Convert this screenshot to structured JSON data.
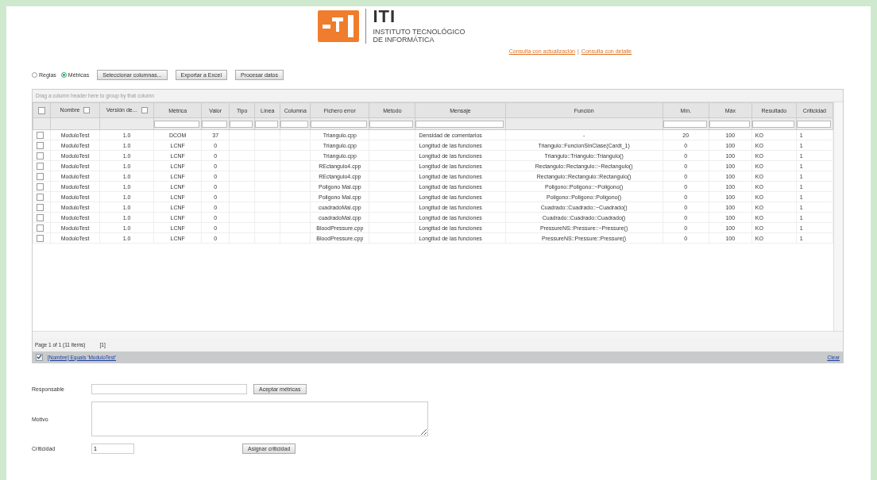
{
  "logo": {
    "acronym": "ITI",
    "name_line_1": "INSTITUTO TECNOLÓGICO",
    "name_line_2": "DE INFORMÁTICA"
  },
  "links": [
    "Consulta con actualización",
    "Consulta con detalle"
  ],
  "link_separator": "|",
  "mode_options": [
    {
      "label": "Reglas",
      "selected": false
    },
    {
      "label": "Métricas",
      "selected": true
    }
  ],
  "toolbar_buttons": [
    "Seleccionar columnas...",
    "Exportar a Excel",
    "Procesar datos"
  ],
  "grid": {
    "group_hint": "Drag a column header here to group by that column",
    "header_checked": false,
    "columns": [
      {
        "label": "Nombre",
        "filter": false,
        "menu": true
      },
      {
        "label": "Versión de...",
        "filter": false,
        "menu": true
      },
      {
        "label": "Métrica",
        "filter": true,
        "menu": false
      },
      {
        "label": "Valor",
        "filter": true,
        "menu": false
      },
      {
        "label": "Tipo",
        "filter": true,
        "menu": false
      },
      {
        "label": "Línea",
        "filter": true,
        "menu": false
      },
      {
        "label": "Columna",
        "filter": true,
        "menu": false
      },
      {
        "label": "Fichero error",
        "filter": true,
        "menu": false
      },
      {
        "label": "Método",
        "filter": true,
        "menu": false
      },
      {
        "label": "Mensaje",
        "filter": true,
        "menu": false
      },
      {
        "label": "Función",
        "filter": false,
        "menu": false
      },
      {
        "label": "Mín.",
        "filter": true,
        "menu": false
      },
      {
        "label": "Máx",
        "filter": true,
        "menu": false
      },
      {
        "label": "Resultado",
        "filter": true,
        "menu": false
      },
      {
        "label": "Criticidad",
        "filter": true,
        "menu": false
      }
    ],
    "rows": [
      {
        "checked": false,
        "cells": [
          "ModuloTest",
          "1.0",
          "DCOM",
          "37",
          "",
          "",
          "",
          "Triangulo.cpp",
          "",
          "Densidad de comentarios",
          "-",
          "20",
          "100",
          "KO",
          "1"
        ]
      },
      {
        "checked": false,
        "cells": [
          "ModuloTest",
          "1.0",
          "LCNF",
          "0",
          "",
          "",
          "",
          "Triangulo.cpp",
          "",
          "Longitud de las funciones",
          "Triangulo::FuncionSinClase(Cardt_1)",
          "0",
          "100",
          "KO",
          "1"
        ]
      },
      {
        "checked": false,
        "cells": [
          "ModuloTest",
          "1.0",
          "LCNF",
          "0",
          "",
          "",
          "",
          "Triangulo.cpp",
          "",
          "Longitud de las funciones",
          "Triangulo::Triangulo::Triangulo()",
          "0",
          "100",
          "KO",
          "1"
        ]
      },
      {
        "checked": false,
        "cells": [
          "ModuloTest",
          "1.0",
          "LCNF",
          "0",
          "",
          "",
          "",
          "REctangulo4.cpp",
          "",
          "Longitud de las funciones",
          "Rectangulo::Rectangulo::~Rectangulo()",
          "0",
          "100",
          "KO",
          "1"
        ]
      },
      {
        "checked": false,
        "cells": [
          "ModuloTest",
          "1.0",
          "LCNF",
          "0",
          "",
          "",
          "",
          "REctangulo4.cpp",
          "",
          "Longitud de las funciones",
          "Rectangulo::Rectangulo::Rectangulo()",
          "0",
          "100",
          "KO",
          "1"
        ]
      },
      {
        "checked": false,
        "cells": [
          "ModuloTest",
          "1.0",
          "LCNF",
          "0",
          "",
          "",
          "",
          "Poligono Mal.cpp",
          "",
          "Longitud de las funciones",
          "Poligono::Poligono::~Poligono()",
          "0",
          "100",
          "KO",
          "1"
        ]
      },
      {
        "checked": false,
        "cells": [
          "ModuloTest",
          "1.0",
          "LCNF",
          "0",
          "",
          "",
          "",
          "Poligono Mal.cpp",
          "",
          "Longitud de las funciones",
          "Poligono::Poligono::Poligono()",
          "0",
          "100",
          "KO",
          "1"
        ]
      },
      {
        "checked": false,
        "cells": [
          "ModuloTest",
          "1.0",
          "LCNF",
          "0",
          "",
          "",
          "",
          "cuadradoMal.cpp",
          "",
          "Longitud de las funciones",
          "Cuadrado::Cuadrado::~Cuadrado()",
          "0",
          "100",
          "KO",
          "1"
        ]
      },
      {
        "checked": false,
        "cells": [
          "ModuloTest",
          "1.0",
          "LCNF",
          "0",
          "",
          "",
          "",
          "cuadradoMal.cpp",
          "",
          "Longitud de las funciones",
          "Cuadrado::Cuadrado::Cuadrado()",
          "0",
          "100",
          "KO",
          "1"
        ]
      },
      {
        "checked": false,
        "cells": [
          "ModuloTest",
          "1.0",
          "LCNF",
          "0",
          "",
          "",
          "",
          "BloodPressure.cpp",
          "",
          "Longitud de las funciones",
          "PressureNS::Pressure::~Pressure()",
          "0",
          "100",
          "KO",
          "1"
        ]
      },
      {
        "checked": false,
        "cells": [
          "ModuloTest",
          "1.0",
          "LCNF",
          "0",
          "",
          "",
          "",
          "BloodPressure.cpp",
          "",
          "Longitud de las funciones",
          "PressureNS::Pressure::Pressure()",
          "0",
          "100",
          "KO",
          "1"
        ]
      }
    ],
    "pager_text": "Page 1 of 1 (11 items)",
    "pager_page": "[1]",
    "filter_enabled": true,
    "filter_expression": "[Nombre] Equals 'ModuloTest'",
    "clear_link": "Clear"
  },
  "form": {
    "responsable_label": "Responsable",
    "accept_button": "Aceptar métricas",
    "motivo_label": "Motivo",
    "criticidad_label": "Criticidad",
    "criticidad_value": "1",
    "assign_button": "Asignar criticidad"
  }
}
